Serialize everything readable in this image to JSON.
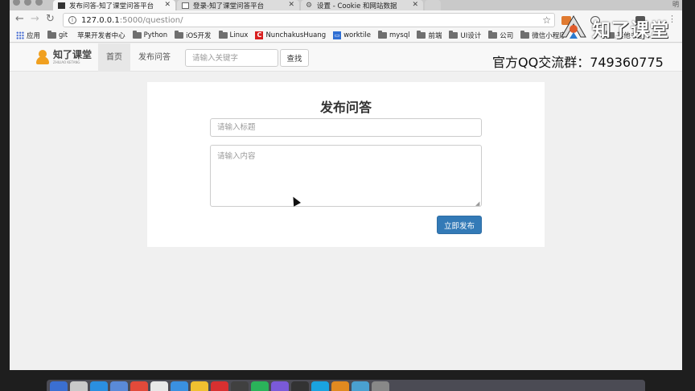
{
  "browser": {
    "tabs": [
      {
        "title": "发布问答-知了课堂问答平台",
        "active": true
      },
      {
        "title": "登录-知了课堂问答平台",
        "active": false
      },
      {
        "title": "设置 - Cookie 和网站数据",
        "active": false
      }
    ],
    "profile_initial": "明",
    "url_host": "127.0.0.1",
    "url_path": ":5000/question/"
  },
  "bookmarks": [
    {
      "label": "应用",
      "icon": "apps-grid-icon"
    },
    {
      "label": "git",
      "icon": "folder-icon"
    },
    {
      "label": "苹果开发者中心",
      "icon": "apple-icon"
    },
    {
      "label": "Python",
      "icon": "folder-icon"
    },
    {
      "label": "iOS开发",
      "icon": "folder-icon"
    },
    {
      "label": "Linux",
      "icon": "folder-icon"
    },
    {
      "label": "NunchakusHuang",
      "icon": "red-c-icon"
    },
    {
      "label": "worktile",
      "icon": "worktile-icon"
    },
    {
      "label": "mysql",
      "icon": "folder-icon"
    },
    {
      "label": "前端",
      "icon": "folder-icon"
    },
    {
      "label": "UI设计",
      "icon": "folder-icon"
    },
    {
      "label": "公司",
      "icon": "folder-icon"
    },
    {
      "label": "微信小程序",
      "icon": "folder-icon"
    },
    {
      "label": "其他书签",
      "icon": "folder-icon"
    }
  ],
  "site": {
    "logo_text": "知了课堂",
    "logo_sub": "ZHILIAO KETANG",
    "nav": [
      {
        "label": "首页",
        "active": true
      },
      {
        "label": "发布问答",
        "active": false
      }
    ],
    "search_placeholder": "请输入关键字",
    "search_button": "查找"
  },
  "form": {
    "heading": "发布问答",
    "title_placeholder": "请输入标题",
    "content_placeholder": "请输入内容",
    "submit_label": "立即发布"
  },
  "overlay": {
    "brand": "知了课堂",
    "qq_text": "官方QQ交流群：749360775"
  },
  "colors": {
    "primary_button": "#337ab7",
    "logo_orange": "#f0a020"
  }
}
